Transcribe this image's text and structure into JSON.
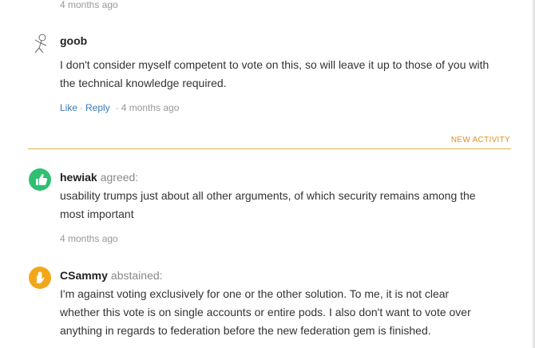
{
  "top": {
    "timestamp": "4 months ago"
  },
  "comments": [
    {
      "author": "goob",
      "verb": "",
      "avatar_icon": "stick-figure-avatar",
      "lines": [
        "I don't consider myself competent to vote on this, so will leave it up to those of you with",
        "the technical knowledge required."
      ],
      "like_label": "Like",
      "reply_label": "Reply",
      "timestamp": "4 months ago"
    },
    {
      "author": "hewiak",
      "verb": "agreed:",
      "avatar_icon": "thumbs-up-icon",
      "avatar_color": "#2fbf71",
      "lines": [
        "usability trumps just about all other arguments, of which security remains among the",
        "most important"
      ],
      "timestamp": "4 months ago"
    },
    {
      "author": "CSammy",
      "verb": "abstained:",
      "avatar_icon": "raised-hand-icon",
      "avatar_color": "#f2a61a",
      "lines": [
        "I'm against voting exclusively for one or the other solution. To me, it is not clear",
        "whether this vote is on single accounts or entire pods. I also don't want to vote over",
        "anything in regards to federation before the new federation gem is finished."
      ]
    }
  ],
  "divider": {
    "label": "NEW ACTIVITY",
    "color": "#e4b24a"
  }
}
